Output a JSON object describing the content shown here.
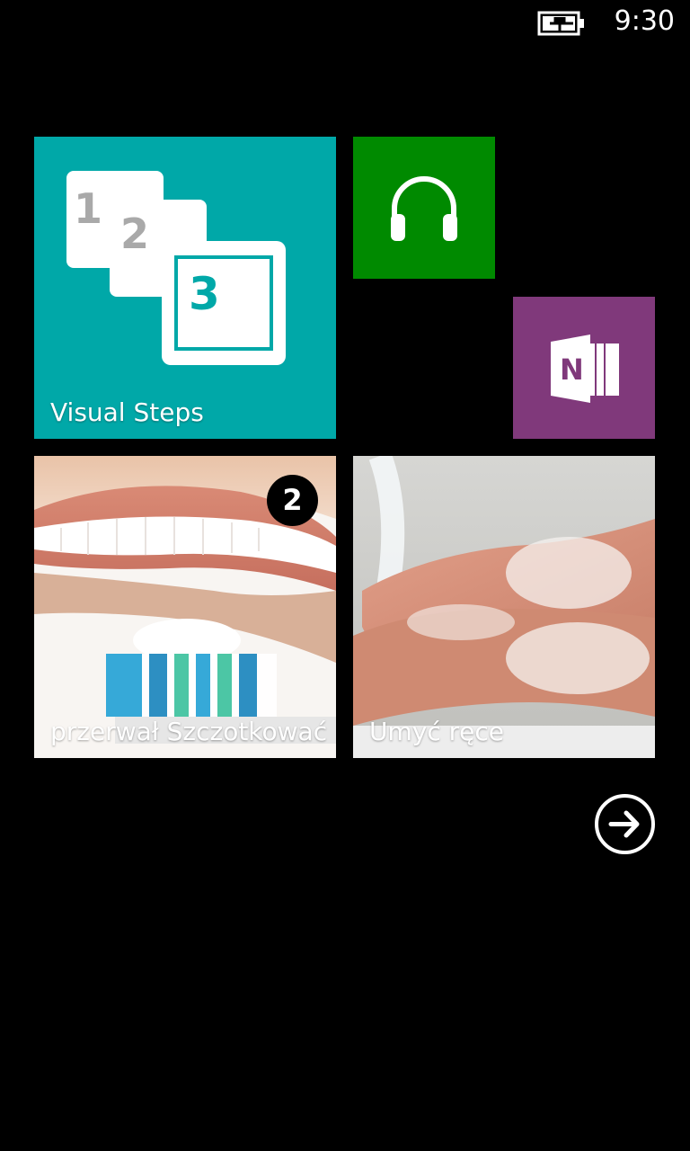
{
  "status_bar": {
    "time": "9:30",
    "battery_icon": "battery-charging-icon"
  },
  "tiles": {
    "visual_steps": {
      "label": "Visual Steps",
      "color": "#00a8a8",
      "icon": "steps-123-icon"
    },
    "music": {
      "color": "#008a00",
      "icon": "headphones-icon"
    },
    "onenote": {
      "color": "#80397b",
      "icon": "onenote-icon"
    },
    "brush_teeth": {
      "label": "przerwał Szczotkować",
      "badge_count": "2",
      "image": "toothbrush-smile-photo"
    },
    "wash_hands": {
      "label": "Umyć ręce",
      "image": "hand-washing-photo"
    }
  },
  "navigation": {
    "more_apps_icon": "arrow-right-circle-icon"
  }
}
